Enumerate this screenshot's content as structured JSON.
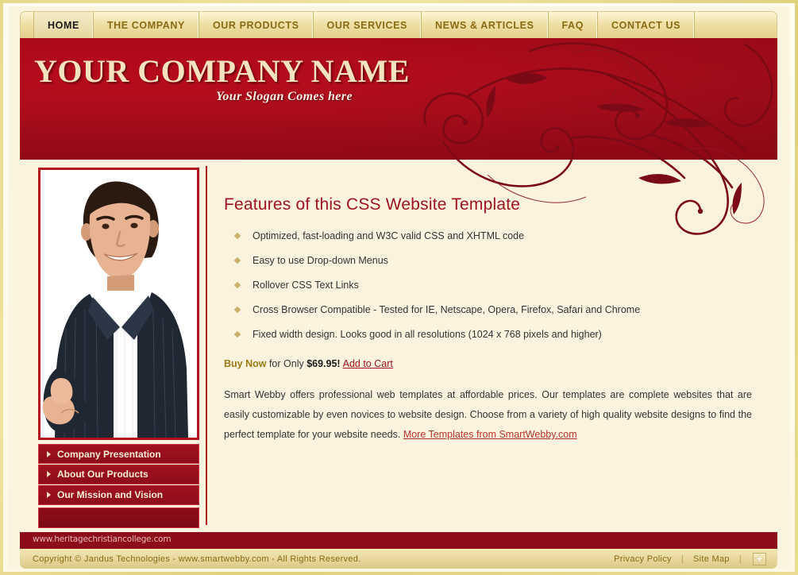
{
  "nav": {
    "items": [
      {
        "label": "HOME",
        "active": true
      },
      {
        "label": "THE COMPANY",
        "active": false
      },
      {
        "label": "OUR PRODUCTS",
        "active": false
      },
      {
        "label": "OUR SERVICES",
        "active": false
      },
      {
        "label": "NEWS & ARTICLES",
        "active": false
      },
      {
        "label": "FAQ",
        "active": false
      },
      {
        "label": "CONTACT US",
        "active": false
      }
    ]
  },
  "header": {
    "company_name": "YOUR COMPANY NAME",
    "slogan": "Your Slogan Comes here",
    "background_color": "#b00d1c",
    "flourish_color": "#7d0a16"
  },
  "sidebar": {
    "photo_alt": "smiling businessman in pinstripe suit pointing forward",
    "menu": [
      {
        "label": "Company Presentation"
      },
      {
        "label": "About Our Products"
      },
      {
        "label": "Our Mission and Vision"
      }
    ]
  },
  "content": {
    "title": "Features of this CSS Website Template",
    "features": [
      "Optimized, fast-loading and W3C valid CSS and XHTML code",
      "Easy to use Drop-down Menus",
      "Rollover CSS Text Links",
      "Cross Browser Compatible - Tested for IE, Netscape, Opera, Firefox, Safari and Chrome",
      "Fixed width design. Looks good in all resolutions (1024 x 768 pixels and higher)"
    ],
    "buy": {
      "buy_now": "Buy Now",
      "for_only": " for Only ",
      "price": "$69.95!",
      "cart_link": "Add to Cart"
    },
    "paragraph": "Smart Webby offers professional web templates at affordable prices. Our templates are complete websites that are easily customizable by even novices to website design. Choose from a variety of high quality website designs to find the perfect template for your website needs. ",
    "paragraph_link": "More Templates from SmartWebby.com"
  },
  "footer": {
    "watermark": "www.heritagechristiancollege.com",
    "copyright": "Copyright © Jandus Technologies - www.smartwebby.com - All Rights Reserved.",
    "privacy_policy": "Privacy Policy",
    "site_map": "Site Map",
    "separator": "|",
    "icon": "rss-icon"
  },
  "colors": {
    "gold_frame": "#e8d98a",
    "red": "#b00d1c",
    "dark_red": "#8d0d1a",
    "cream": "#fbf3dd",
    "link_red": "#9e1320"
  }
}
